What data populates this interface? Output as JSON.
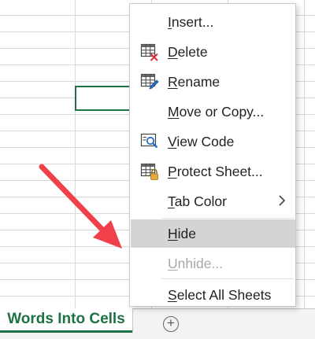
{
  "sheet_tab": {
    "label": "Words Into Cells"
  },
  "add_sheet": {
    "glyph": "+"
  },
  "menu": {
    "items": [
      {
        "pre": "",
        "mn": "I",
        "post": "nsert..."
      },
      {
        "pre": "",
        "mn": "D",
        "post": "elete"
      },
      {
        "pre": "",
        "mn": "R",
        "post": "ename"
      },
      {
        "pre": "",
        "mn": "M",
        "post": "ove or Copy..."
      },
      {
        "pre": "",
        "mn": "V",
        "post": "iew Code"
      },
      {
        "pre": "",
        "mn": "P",
        "post": "rotect Sheet..."
      },
      {
        "pre": "",
        "mn": "T",
        "post": "ab Color"
      },
      {
        "pre": "",
        "mn": "H",
        "post": "ide"
      },
      {
        "pre": "",
        "mn": "U",
        "post": "nhide..."
      },
      {
        "pre": "",
        "mn": "S",
        "post": "elect All Sheets"
      }
    ],
    "hovered": "Hide",
    "disabled": "Unhide..."
  },
  "colors": {
    "excel_green": "#1e7145",
    "arrow_red": "#f0404a",
    "hover_bg": "#d4d4d4"
  },
  "icons": [
    "delete-sheet-icon",
    "rename-sheet-icon",
    "view-code-icon",
    "protect-sheet-icon",
    "chevron-right-icon",
    "add-sheet-icon"
  ]
}
